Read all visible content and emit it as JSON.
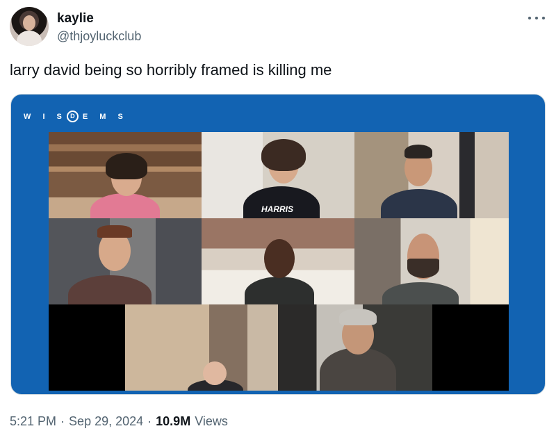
{
  "author": {
    "display_name": "kaylie",
    "handle": "@thjoyluckclub"
  },
  "tweet": {
    "text": "larry david being so horribly framed is killing me"
  },
  "media": {
    "brand_text_before": "W I S",
    "brand_logo_letter": "D",
    "brand_text_after": "E M S",
    "tile_shirt_text": "HARRIS"
  },
  "meta": {
    "time": "5:21 PM",
    "separator": "·",
    "date": "Sep 29, 2024",
    "views_count": "10.9M",
    "views_label": "Views"
  },
  "colors": {
    "media_bg": "#1263b2",
    "text_primary": "#0f1419",
    "text_secondary": "#536471"
  },
  "icons": {
    "more": "more-horizontal-icon"
  }
}
